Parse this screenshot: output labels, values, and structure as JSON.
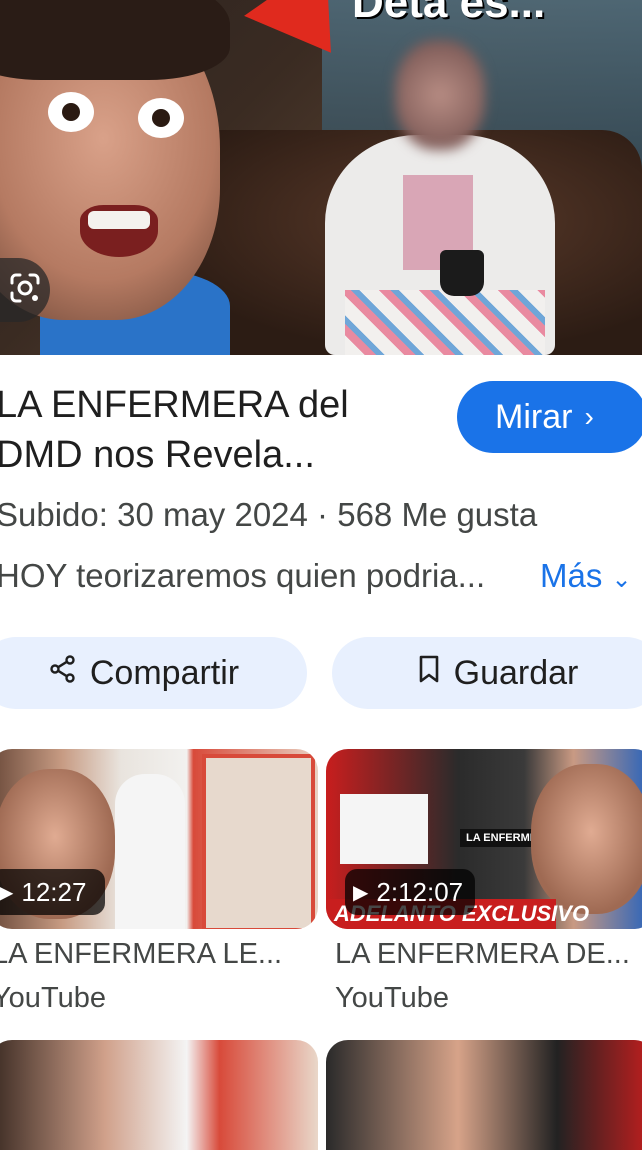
{
  "hero": {
    "overlay_text": "Deta es...",
    "lens_icon": "google-lens-icon"
  },
  "video": {
    "title": "LA ENFERMERA del DMD nos Revela...",
    "watch_label": "Mirar",
    "meta": "Subido: 30 may 2024 · 568 Me gusta",
    "description": "HOY teorizaremos quien podria...",
    "more_label": "Más"
  },
  "actions": {
    "share_label": "Compartir",
    "save_label": "Guardar"
  },
  "related": [
    {
      "title": "LA ENFERMERA LE...",
      "source": "YouTube",
      "duration": "12:27"
    },
    {
      "title": "LA ENFERMERA DE...",
      "source": "YouTube",
      "duration": "2:12:07",
      "thumb_tag": "LA ENFERMERA HA LLEGADO",
      "thumb_banner": "ADELANTO EXCLUSIVO"
    }
  ],
  "colors": {
    "accent": "#1a73e8",
    "pill_bg": "#e8f0fe",
    "text": "#1f1f1f",
    "secondary": "#444746"
  }
}
